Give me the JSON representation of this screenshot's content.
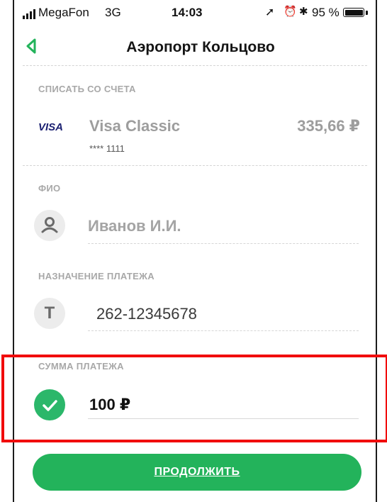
{
  "status_bar": {
    "carrier": "MegaFon",
    "network": "3G",
    "time": "14:03",
    "battery_percent": "95 %",
    "battery_level": 0.95
  },
  "header": {
    "title": "Аэропорт Кольцово",
    "back_icon": "chevron-left-icon"
  },
  "account": {
    "label": "СПИСАТЬ СО СЧЕТА",
    "card_brand": "VISA",
    "card_name": "Visa Classic",
    "card_mask": "**** 1111",
    "balance": "335,66 ₽"
  },
  "fio": {
    "label": "ФИО",
    "icon": "person-icon",
    "value": "Иванов И.И."
  },
  "purpose": {
    "label": "НАЗНАЧЕНИЕ ПЛАТЕЖА",
    "icon_letter": "T",
    "value": "262-12345678"
  },
  "amount": {
    "label": "СУММА ПЛАТЕЖА",
    "icon": "checkmark-icon",
    "value": "100 ₽"
  },
  "continue_button": {
    "label": "ПРОДОЛЖИТЬ"
  },
  "colors": {
    "accent_green": "#23b35b",
    "highlight_red": "#f10b0b",
    "label_gray": "#a8a8a8"
  }
}
